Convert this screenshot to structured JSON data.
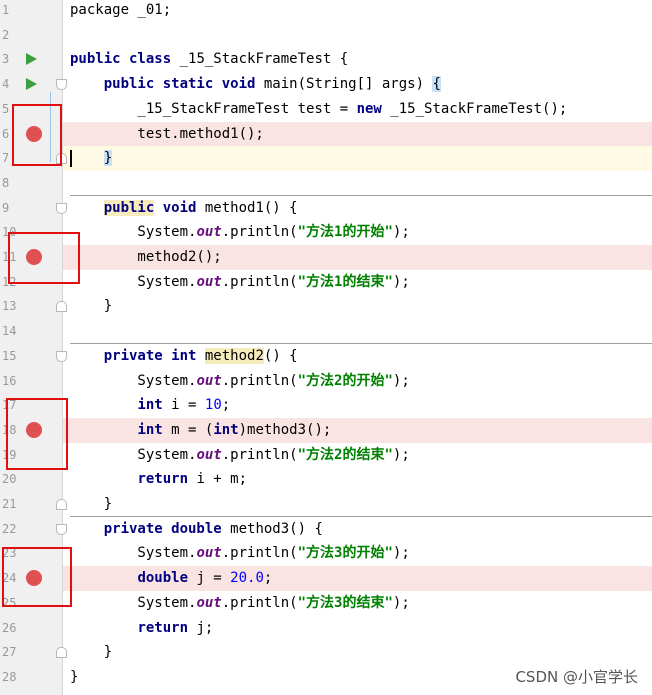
{
  "editor": {
    "line_numbers": [
      "1",
      "2",
      "3",
      "4",
      "5",
      "6",
      "7",
      "8",
      "9",
      "10",
      "11",
      "12",
      "13",
      "14",
      "15",
      "16",
      "17",
      "18",
      "19",
      "20",
      "21",
      "22",
      "23",
      "24",
      "25",
      "26",
      "27",
      "28"
    ],
    "lines": [
      {
        "n": "1",
        "tokens": [
          {
            "t": "package _01;",
            "c": ""
          }
        ]
      },
      {
        "n": "2",
        "tokens": []
      },
      {
        "n": "3",
        "tokens": [
          {
            "t": "public class",
            "c": "kw"
          },
          {
            "t": " _15_StackFrameTest {",
            "c": ""
          }
        ]
      },
      {
        "n": "4",
        "tokens": [
          {
            "t": "    ",
            "c": ""
          },
          {
            "t": "public static void",
            "c": "kw"
          },
          {
            "t": " main(String[] args) ",
            "c": ""
          },
          {
            "t": "{",
            "c": "brace-match"
          }
        ]
      },
      {
        "n": "5",
        "tokens": [
          {
            "t": "        _15_StackFrameTest test = ",
            "c": ""
          },
          {
            "t": "new",
            "c": "kw"
          },
          {
            "t": " _15_StackFrameTest();",
            "c": ""
          }
        ]
      },
      {
        "n": "6",
        "tokens": [
          {
            "t": "        test.method1();",
            "c": ""
          }
        ]
      },
      {
        "n": "7",
        "tokens": [
          {
            "t": "    ",
            "c": ""
          },
          {
            "t": "}",
            "c": "brace-match"
          }
        ]
      },
      {
        "n": "8",
        "tokens": []
      },
      {
        "n": "9",
        "tokens": [
          {
            "t": "    ",
            "c": ""
          },
          {
            "t": "public",
            "c": "kw hl"
          },
          {
            "t": " ",
            "c": ""
          },
          {
            "t": "void",
            "c": "kw"
          },
          {
            "t": " method1() {",
            "c": ""
          }
        ]
      },
      {
        "n": "10",
        "tokens": [
          {
            "t": "        System.",
            "c": ""
          },
          {
            "t": "out",
            "c": "field"
          },
          {
            "t": ".println(",
            "c": ""
          },
          {
            "t": "\"方法1的开始\"",
            "c": "str"
          },
          {
            "t": ");",
            "c": ""
          }
        ]
      },
      {
        "n": "11",
        "tokens": [
          {
            "t": "        method2();",
            "c": ""
          }
        ]
      },
      {
        "n": "12",
        "tokens": [
          {
            "t": "        System.",
            "c": ""
          },
          {
            "t": "out",
            "c": "field"
          },
          {
            "t": ".println(",
            "c": ""
          },
          {
            "t": "\"方法1的结束\"",
            "c": "str"
          },
          {
            "t": ");",
            "c": ""
          }
        ]
      },
      {
        "n": "13",
        "tokens": [
          {
            "t": "    }",
            "c": ""
          }
        ]
      },
      {
        "n": "14",
        "tokens": []
      },
      {
        "n": "15",
        "tokens": [
          {
            "t": "    ",
            "c": ""
          },
          {
            "t": "private int",
            "c": "kw"
          },
          {
            "t": " ",
            "c": ""
          },
          {
            "t": "method2",
            "c": "hl"
          },
          {
            "t": "() {",
            "c": ""
          }
        ]
      },
      {
        "n": "16",
        "tokens": [
          {
            "t": "        System.",
            "c": ""
          },
          {
            "t": "out",
            "c": "field"
          },
          {
            "t": ".println(",
            "c": ""
          },
          {
            "t": "\"方法2的开始\"",
            "c": "str"
          },
          {
            "t": ");",
            "c": ""
          }
        ]
      },
      {
        "n": "17",
        "tokens": [
          {
            "t": "        ",
            "c": ""
          },
          {
            "t": "int",
            "c": "kw"
          },
          {
            "t": " i = ",
            "c": ""
          },
          {
            "t": "10",
            "c": "num"
          },
          {
            "t": ";",
            "c": ""
          }
        ]
      },
      {
        "n": "18",
        "tokens": [
          {
            "t": "        ",
            "c": ""
          },
          {
            "t": "int",
            "c": "kw"
          },
          {
            "t": " m = (",
            "c": ""
          },
          {
            "t": "int",
            "c": "kw"
          },
          {
            "t": ")method3();",
            "c": ""
          }
        ]
      },
      {
        "n": "19",
        "tokens": [
          {
            "t": "        System.",
            "c": ""
          },
          {
            "t": "out",
            "c": "field"
          },
          {
            "t": ".println(",
            "c": ""
          },
          {
            "t": "\"方法2的结束\"",
            "c": "str"
          },
          {
            "t": ");",
            "c": ""
          }
        ]
      },
      {
        "n": "20",
        "tokens": [
          {
            "t": "        ",
            "c": ""
          },
          {
            "t": "return",
            "c": "kw"
          },
          {
            "t": " i + m;",
            "c": ""
          }
        ]
      },
      {
        "n": "21",
        "tokens": [
          {
            "t": "    }",
            "c": ""
          }
        ]
      },
      {
        "n": "22",
        "tokens": [
          {
            "t": "    ",
            "c": ""
          },
          {
            "t": "private double",
            "c": "kw"
          },
          {
            "t": " method3() {",
            "c": ""
          }
        ]
      },
      {
        "n": "23",
        "tokens": [
          {
            "t": "        System.",
            "c": ""
          },
          {
            "t": "out",
            "c": "field"
          },
          {
            "t": ".println(",
            "c": ""
          },
          {
            "t": "\"方法3的开始\"",
            "c": "str"
          },
          {
            "t": ");",
            "c": ""
          }
        ]
      },
      {
        "n": "24",
        "tokens": [
          {
            "t": "        ",
            "c": ""
          },
          {
            "t": "double",
            "c": "kw"
          },
          {
            "t": " j = ",
            "c": ""
          },
          {
            "t": "20.0",
            "c": "num"
          },
          {
            "t": ";",
            "c": ""
          }
        ]
      },
      {
        "n": "25",
        "tokens": [
          {
            "t": "        System.",
            "c": ""
          },
          {
            "t": "out",
            "c": "field"
          },
          {
            "t": ".println(",
            "c": ""
          },
          {
            "t": "\"方法3的结束\"",
            "c": "str"
          },
          {
            "t": ");",
            "c": ""
          }
        ]
      },
      {
        "n": "26",
        "tokens": [
          {
            "t": "        ",
            "c": ""
          },
          {
            "t": "return",
            "c": "kw"
          },
          {
            "t": " j;",
            "c": ""
          }
        ]
      },
      {
        "n": "27",
        "tokens": [
          {
            "t": "    }",
            "c": ""
          }
        ]
      },
      {
        "n": "28",
        "tokens": [
          {
            "t": "}",
            "c": ""
          }
        ]
      }
    ],
    "breakpoint_lines": [
      "6",
      "11",
      "18",
      "24"
    ],
    "run_lines": [
      "3",
      "4"
    ],
    "caret_line": "7",
    "fold_open_lines": [
      "4",
      "9",
      "15",
      "22"
    ],
    "fold_close_lines": [
      "7",
      "13",
      "21",
      "27"
    ],
    "separator_after_lines": [
      "8",
      "14",
      "21"
    ],
    "icons": {
      "run": "run-gutter-icon",
      "breakpoint": "breakpoint-icon",
      "fold": "fold-marker-icon"
    }
  },
  "watermark": "CSDN @小官学长",
  "colors": {
    "keyword": "#000080",
    "string": "#008000",
    "number": "#0000ff",
    "field": "#660e7a",
    "breakpoint": "#e05050",
    "breakpoint_line_bg": "#fae3e3",
    "highlight_box": "#e01010"
  }
}
